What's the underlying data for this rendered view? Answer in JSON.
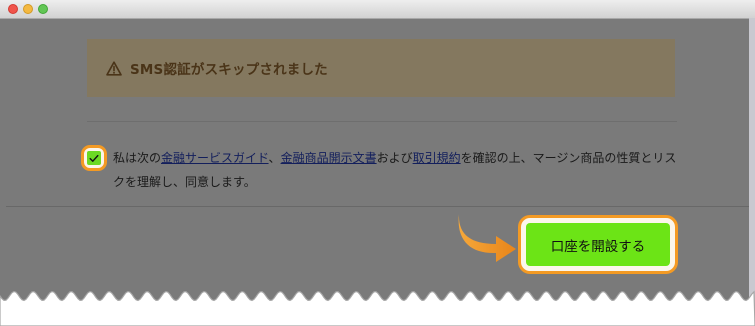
{
  "alert": {
    "icon": "warning-triangle-icon",
    "message": "SMS認証がスキップされました"
  },
  "consent": {
    "checked": true,
    "prefix": "私は次の",
    "link1": "金融サービスガイド",
    "sep1": "、",
    "link2": "金融商品開示文書",
    "mid": "および",
    "link3": "取引規約",
    "suffix": "を確認の上、マージン商品の性質とリスクを理解し、同意します。"
  },
  "submit_button": {
    "label": "口座を開設する"
  },
  "colors": {
    "overlay": "#7a7a7a",
    "highlight": "#f39a24",
    "button": "#6ce416"
  }
}
